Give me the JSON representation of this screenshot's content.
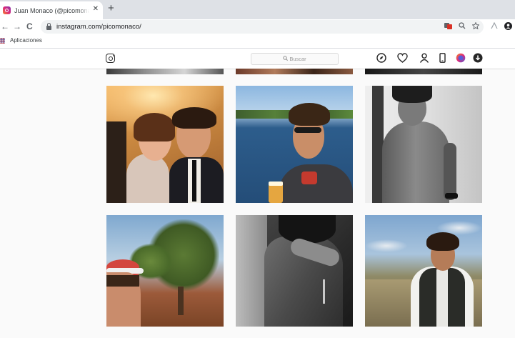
{
  "browser": {
    "tab": {
      "title": "Juan Monaco (@picomonaco) • I",
      "close_icon": "✕"
    },
    "new_tab_icon": "+",
    "nav": {
      "back": "←",
      "forward": "→",
      "reload": "C"
    },
    "address": {
      "url": "instagram.com/picomonaco/"
    },
    "bookmarks": {
      "apps_label": "Aplicaciones"
    }
  },
  "instagram": {
    "search": {
      "placeholder": "Buscar"
    },
    "icons": [
      "instagram-logo-icon",
      "explore-compass-icon",
      "heart-icon",
      "profile-icon",
      "phone-icon",
      "extension-avatar-icon",
      "download-icon"
    ]
  },
  "grid": {
    "rows": [
      {
        "partial": true,
        "photos": [
          "top-left-partial",
          "top-middle-partial",
          "top-right-partial"
        ]
      },
      {
        "photos": [
          "couple-selfie-gold-room",
          "man-sunglasses-lake-beer",
          "bw-shirtless-portrait"
        ]
      },
      {
        "photos": [
          "selfie-red-cap-olive-tree",
          "bw-shirtless-closeup",
          "man-vest-coastline"
        ]
      }
    ]
  },
  "colors": {
    "instagram_bg": "#fafafa",
    "chrome_tabbar": "#dee1e6",
    "omnibox": "#f1f3f4",
    "lake_blue": "#2d5d8c",
    "sky_blue": "#8cb7e0"
  }
}
